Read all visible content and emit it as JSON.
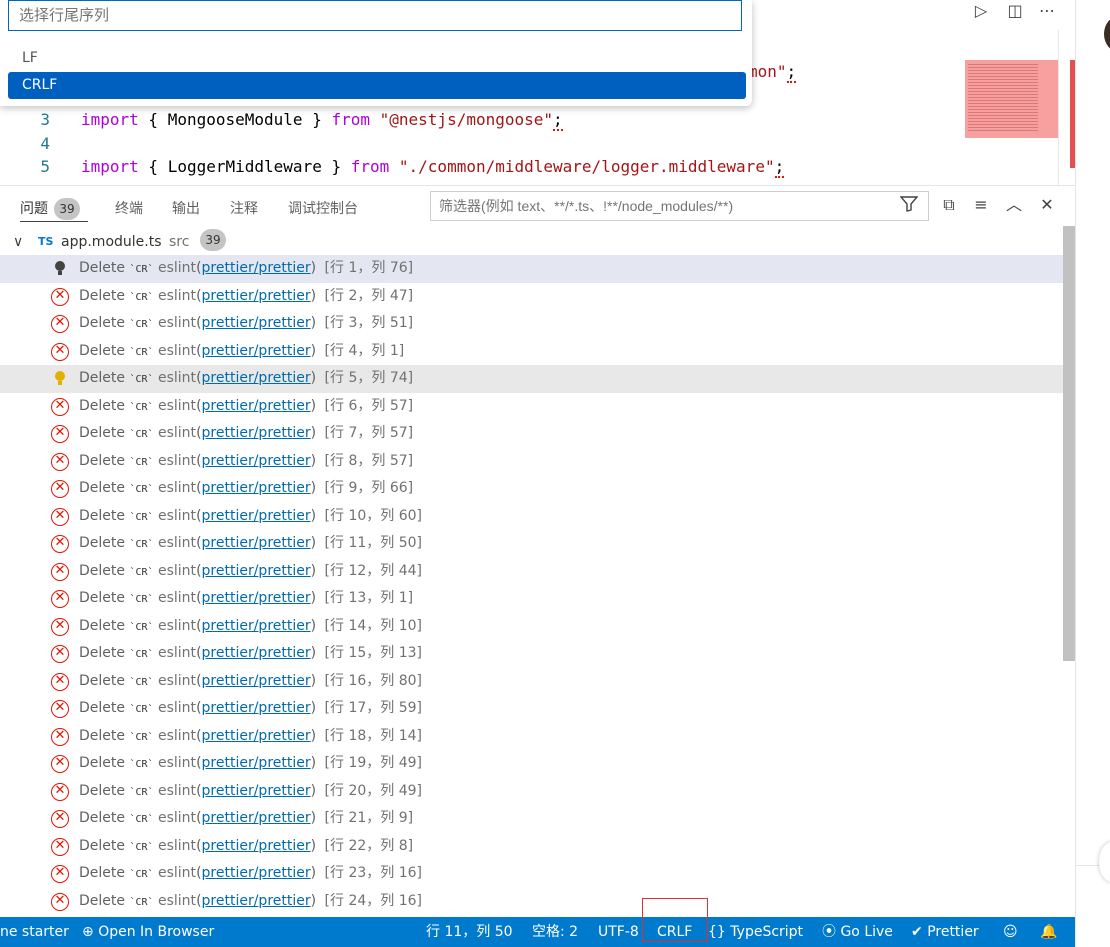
{
  "quick_pick": {
    "placeholder": "选择行尾序列",
    "items": [
      "LF",
      "CRLF"
    ],
    "selected": "CRLF"
  },
  "editor": {
    "partial_top": {
      "str_tail": "mon\"",
      "semi": ";"
    },
    "lines": [
      {
        "num": "3",
        "kw": "import",
        "open": " { ",
        "ident": "MongooseModule",
        "close": " } ",
        "from": "from",
        "str": " \"@nestjs/mongoose\"",
        "semi": ";"
      },
      {
        "num": "4"
      },
      {
        "num": "5",
        "kw": "import",
        "open": " { ",
        "ident": "LoggerMiddleware",
        "close": " } ",
        "from": "from",
        "str": " \"./common/middleware/logger.middleware\"",
        "semi": ";"
      }
    ],
    "toolbar_icons": [
      "run-icon",
      "split-editor-icon",
      "more-actions-icon"
    ]
  },
  "panel": {
    "tabs": [
      {
        "label": "问题",
        "badge": "39"
      },
      {
        "label": "终端"
      },
      {
        "label": "输出"
      },
      {
        "label": "注释"
      },
      {
        "label": "调试控制台"
      }
    ],
    "filter_placeholder": "筛选器(例如 text、**/*.ts、!**/node_modules/**)",
    "file": {
      "icon": "TS",
      "name": "app.module.ts",
      "folder": "src",
      "count": "39"
    },
    "problems": [
      {
        "icon": "bulb-dark",
        "msg": "Delete",
        "code": "`CR`",
        "src": "eslint",
        "rule": "prettier/prettier",
        "pos": "[行 1，列 76]"
      },
      {
        "icon": "error",
        "msg": "Delete",
        "code": "`CR`",
        "src": "eslint",
        "rule": "prettier/prettier",
        "pos": "[行 2，列 47]"
      },
      {
        "icon": "error",
        "msg": "Delete",
        "code": "`CR`",
        "src": "eslint",
        "rule": "prettier/prettier",
        "pos": "[行 3，列 51]"
      },
      {
        "icon": "error",
        "msg": "Delete",
        "code": "`CR`",
        "src": "eslint",
        "rule": "prettier/prettier",
        "pos": "[行 4，列 1]"
      },
      {
        "icon": "bulb-yellow",
        "msg": "Delete",
        "code": "`CR`",
        "src": "eslint",
        "rule": "prettier/prettier",
        "pos": "[行 5，列 74]"
      },
      {
        "icon": "error",
        "msg": "Delete",
        "code": "`CR`",
        "src": "eslint",
        "rule": "prettier/prettier",
        "pos": "[行 6，列 57]"
      },
      {
        "icon": "error",
        "msg": "Delete",
        "code": "`CR`",
        "src": "eslint",
        "rule": "prettier/prettier",
        "pos": "[行 7，列 57]"
      },
      {
        "icon": "error",
        "msg": "Delete",
        "code": "`CR`",
        "src": "eslint",
        "rule": "prettier/prettier",
        "pos": "[行 8，列 57]"
      },
      {
        "icon": "error",
        "msg": "Delete",
        "code": "`CR`",
        "src": "eslint",
        "rule": "prettier/prettier",
        "pos": "[行 9，列 66]"
      },
      {
        "icon": "error",
        "msg": "Delete",
        "code": "`CR`",
        "src": "eslint",
        "rule": "prettier/prettier",
        "pos": "[行 10，列 60]"
      },
      {
        "icon": "error",
        "msg": "Delete",
        "code": "`CR`",
        "src": "eslint",
        "rule": "prettier/prettier",
        "pos": "[行 11，列 50]"
      },
      {
        "icon": "error",
        "msg": "Delete",
        "code": "`CR`",
        "src": "eslint",
        "rule": "prettier/prettier",
        "pos": "[行 12，列 44]"
      },
      {
        "icon": "error",
        "msg": "Delete",
        "code": "`CR`",
        "src": "eslint",
        "rule": "prettier/prettier",
        "pos": "[行 13，列 1]"
      },
      {
        "icon": "error",
        "msg": "Delete",
        "code": "`CR`",
        "src": "eslint",
        "rule": "prettier/prettier",
        "pos": "[行 14，列 10]"
      },
      {
        "icon": "error",
        "msg": "Delete",
        "code": "`CR`",
        "src": "eslint",
        "rule": "prettier/prettier",
        "pos": "[行 15，列 13]"
      },
      {
        "icon": "error",
        "msg": "Delete",
        "code": "`CR`",
        "src": "eslint",
        "rule": "prettier/prettier",
        "pos": "[行 16，列 80]"
      },
      {
        "icon": "error",
        "msg": "Delete",
        "code": "`CR`",
        "src": "eslint",
        "rule": "prettier/prettier",
        "pos": "[行 17，列 59]"
      },
      {
        "icon": "error",
        "msg": "Delete",
        "code": "`CR`",
        "src": "eslint",
        "rule": "prettier/prettier",
        "pos": "[行 18，列 14]"
      },
      {
        "icon": "error",
        "msg": "Delete",
        "code": "`CR`",
        "src": "eslint",
        "rule": "prettier/prettier",
        "pos": "[行 19，列 49]"
      },
      {
        "icon": "error",
        "msg": "Delete",
        "code": "`CR`",
        "src": "eslint",
        "rule": "prettier/prettier",
        "pos": "[行 20，列 49]"
      },
      {
        "icon": "error",
        "msg": "Delete",
        "code": "`CR`",
        "src": "eslint",
        "rule": "prettier/prettier",
        "pos": "[行 21，列 9]"
      },
      {
        "icon": "error",
        "msg": "Delete",
        "code": "`CR`",
        "src": "eslint",
        "rule": "prettier/prettier",
        "pos": "[行 22，列 8]"
      },
      {
        "icon": "error",
        "msg": "Delete",
        "code": "`CR`",
        "src": "eslint",
        "rule": "prettier/prettier",
        "pos": "[行 23，列 16]"
      },
      {
        "icon": "error",
        "msg": "Delete",
        "code": "`CR`",
        "src": "eslint",
        "rule": "prettier/prettier",
        "pos": "[行 24，列 16]"
      }
    ]
  },
  "status_bar": {
    "left_partial": "ne starter",
    "open_in_browser": "Open In Browser",
    "position": "行 11，列 50",
    "spaces": "空格: 2",
    "encoding": "UTF-8",
    "eol": "CRLF",
    "language": "TypeScript",
    "go_live": "Go Live",
    "prettier": "Prettier"
  },
  "colors": {
    "accent": "#007acc",
    "selection": "#0060c0",
    "error": "#e51400",
    "highlight_box": "#e03131"
  }
}
